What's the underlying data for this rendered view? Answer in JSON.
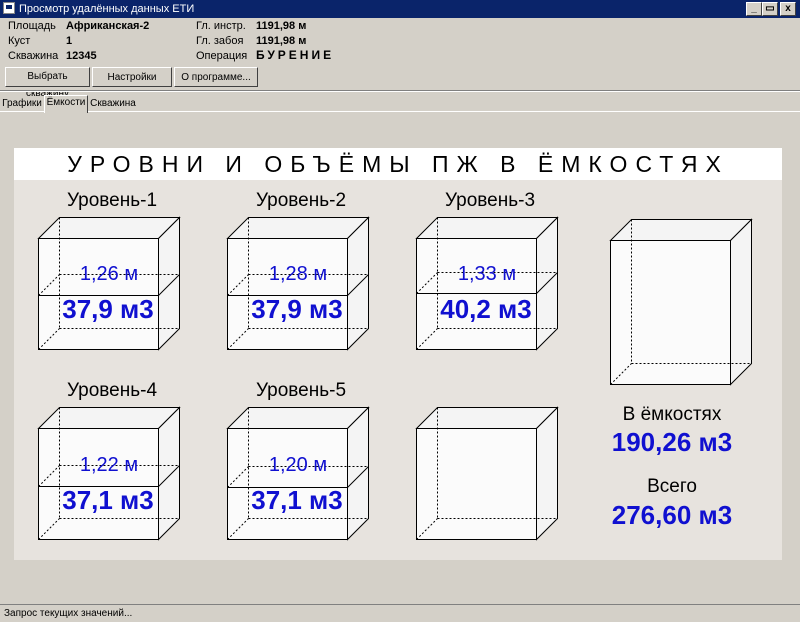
{
  "window": {
    "title": "Просмотр удалённых данных ЕТИ",
    "min_glyph": "_",
    "max_glyph": "▭",
    "close_glyph": "x"
  },
  "info": {
    "area_label": "Площадь",
    "area_value": "Африканская-2",
    "pad_label": "Куст",
    "pad_value": "1",
    "well_label": "Скважина",
    "well_value": "12345",
    "depth_instr_label": "Гл. инстр.",
    "depth_instr_value": "1191,98 м",
    "depth_bottom_label": "Гл. забоя",
    "depth_bottom_value": "1191,98 м",
    "operation_label": "Операция",
    "operation_value": "БУРЕНИЕ"
  },
  "toolbar": {
    "select_well": "Выбрать скважину",
    "settings": "Настройки",
    "about": "О программе..."
  },
  "tabs": [
    "Графики",
    "Ёмкости",
    "Скважина"
  ],
  "panel": {
    "title": "УРОВНИ И ОБЪЁМЫ ПЖ В ЁМКОСТЯХ",
    "tanks": [
      {
        "label": "Уровень-1",
        "level": "1,26 м",
        "volume": "37,9 м3"
      },
      {
        "label": "Уровень-2",
        "level": "1,28 м",
        "volume": "37,9 м3"
      },
      {
        "label": "Уровень-3",
        "level": "1,33 м",
        "volume": "40,2 м3"
      },
      {
        "label": "Уровень-4",
        "level": "1,22 м",
        "volume": "37,1 м3"
      },
      {
        "label": "Уровень-5",
        "level": "1,20 м",
        "volume": "37,1 м3"
      }
    ],
    "in_tanks_label": "В ёмкостях",
    "in_tanks_value": "190,26 м3",
    "total_label": "Всего",
    "total_value": "276,60 м3"
  },
  "status": {
    "text": "Запрос текущих значений..."
  },
  "colors": {
    "title_bar": "#0a246a",
    "accent_blue": "#1010d0",
    "window_bg": "#d4d0c8"
  }
}
